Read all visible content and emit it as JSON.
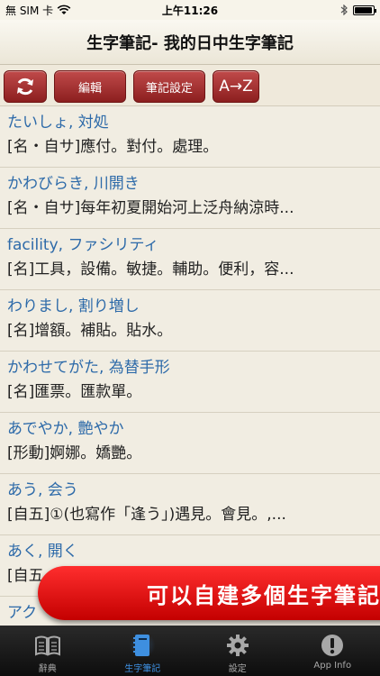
{
  "status": {
    "carrier": "無 SIM 卡",
    "time": "上午11:26"
  },
  "nav": {
    "title": "生字筆記- 我的日中生字筆記"
  },
  "toolbar": {
    "edit_label": "編輯",
    "note_settings_label": "筆記設定",
    "sort_label": "A→Z"
  },
  "entries": [
    {
      "word": "たいしょ, 対処",
      "meaning": "[名・自サ]應付。對付。處理。"
    },
    {
      "word": "かわびらき, 川開き",
      "meaning": "[名・自サ]每年初夏開始河上泛舟納涼時..."
    },
    {
      "word": "facility, ファシリティ",
      "meaning": "[名]工具，設備。敏捷。輔助。便利，容..."
    },
    {
      "word": "わりまし, 割り増し",
      "meaning": "[名]增額。補貼。貼水。"
    },
    {
      "word": "かわせてがた, 為替手形",
      "meaning": "[名]匯票。匯款單。"
    },
    {
      "word": "あでやか, 艶やか",
      "meaning": "[形動]婀娜。嬌艷。"
    },
    {
      "word": "あう, 会う",
      "meaning": "[自五]①(也寫作「逢う」)遇見。會見。,..."
    },
    {
      "word": "あく, 開く",
      "meaning": "[自五"
    },
    {
      "word": "アク",
      "meaning": ""
    }
  ],
  "promo": {
    "text": "可以自建多個生字筆記"
  },
  "tabs": [
    {
      "label": "辭典",
      "icon": "book-icon"
    },
    {
      "label": "生字筆記",
      "icon": "notebook-icon"
    },
    {
      "label": "設定",
      "icon": "gear-icon"
    },
    {
      "label": "App Info",
      "icon": "info-icon"
    }
  ],
  "colors": {
    "accent_red": "#b02a2a",
    "word_blue": "#2d6aa9",
    "active_tab": "#3e8fe0"
  }
}
